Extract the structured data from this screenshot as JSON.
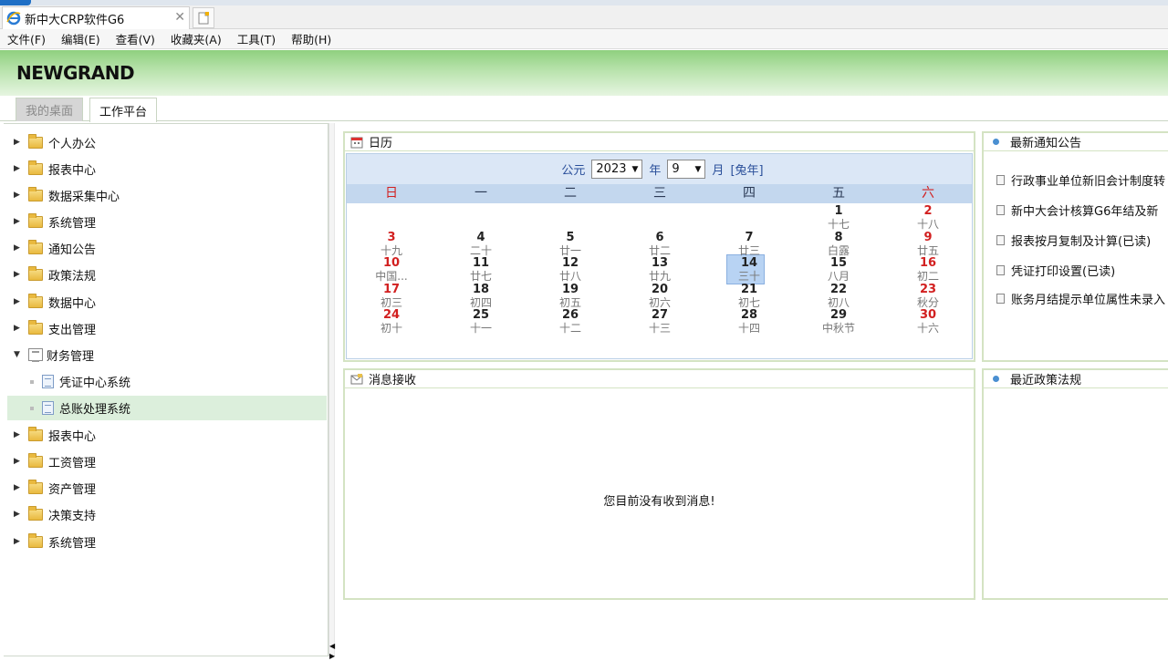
{
  "browser": {
    "tab_title": "新中大CRP软件G6",
    "close_glyph": "✕",
    "menu": [
      "文件(F)",
      "编辑(E)",
      "查看(V)",
      "收藏夹(A)",
      "工具(T)",
      "帮助(H)"
    ]
  },
  "app": {
    "logo": "NEWGRAND",
    "tabs": [
      "我的桌面",
      "工作平台"
    ]
  },
  "sidebar": {
    "items": [
      {
        "label": "个人办公"
      },
      {
        "label": "报表中心"
      },
      {
        "label": "数据采集中心"
      },
      {
        "label": "系统管理"
      },
      {
        "label": "通知公告"
      },
      {
        "label": "政策法规"
      },
      {
        "label": "数据中心"
      },
      {
        "label": "支出管理"
      },
      {
        "label": "财务管理",
        "expanded": true
      },
      {
        "label": "报表中心"
      },
      {
        "label": "工资管理"
      },
      {
        "label": "资产管理"
      },
      {
        "label": "决策支持"
      },
      {
        "label": "系统管理"
      }
    ],
    "finance_children": [
      "凭证中心系统",
      "总账处理系统"
    ],
    "selected_child": "总账处理系统"
  },
  "calendar": {
    "title": "日历",
    "era_label": "公元",
    "year": "2023",
    "year_unit": "年",
    "month": "9",
    "month_unit": "月",
    "zodiac": "[兔年]",
    "weekdays": [
      "日",
      "一",
      "二",
      "三",
      "四",
      "五",
      "六"
    ],
    "days": [
      {
        "n": "1",
        "l": "十七",
        "col": 5,
        "row": 0
      },
      {
        "n": "2",
        "l": "十八",
        "col": 6,
        "row": 0
      },
      {
        "n": "3",
        "l": "十九",
        "col": 0,
        "row": 1
      },
      {
        "n": "4",
        "l": "二十",
        "col": 1,
        "row": 1
      },
      {
        "n": "5",
        "l": "廿一",
        "col": 2,
        "row": 1
      },
      {
        "n": "6",
        "l": "廿二",
        "col": 3,
        "row": 1
      },
      {
        "n": "7",
        "l": "廿三",
        "col": 4,
        "row": 1
      },
      {
        "n": "8",
        "l": "白露",
        "col": 5,
        "row": 1
      },
      {
        "n": "9",
        "l": "廿五",
        "col": 6,
        "row": 1
      },
      {
        "n": "10",
        "l": "中国...",
        "col": 0,
        "row": 2
      },
      {
        "n": "11",
        "l": "廿七",
        "col": 1,
        "row": 2
      },
      {
        "n": "12",
        "l": "廿八",
        "col": 2,
        "row": 2
      },
      {
        "n": "13",
        "l": "廿九",
        "col": 3,
        "row": 2
      },
      {
        "n": "14",
        "l": "三十",
        "col": 4,
        "row": 2,
        "today": true
      },
      {
        "n": "15",
        "l": "八月",
        "col": 5,
        "row": 2
      },
      {
        "n": "16",
        "l": "初二",
        "col": 6,
        "row": 2
      },
      {
        "n": "17",
        "l": "初三",
        "col": 0,
        "row": 3
      },
      {
        "n": "18",
        "l": "初四",
        "col": 1,
        "row": 3
      },
      {
        "n": "19",
        "l": "初五",
        "col": 2,
        "row": 3
      },
      {
        "n": "20",
        "l": "初六",
        "col": 3,
        "row": 3
      },
      {
        "n": "21",
        "l": "初七",
        "col": 4,
        "row": 3
      },
      {
        "n": "22",
        "l": "初八",
        "col": 5,
        "row": 3
      },
      {
        "n": "23",
        "l": "秋分",
        "col": 6,
        "row": 3
      },
      {
        "n": "24",
        "l": "初十",
        "col": 0,
        "row": 4
      },
      {
        "n": "25",
        "l": "十一",
        "col": 1,
        "row": 4
      },
      {
        "n": "26",
        "l": "十二",
        "col": 2,
        "row": 4
      },
      {
        "n": "27",
        "l": "十三",
        "col": 3,
        "row": 4
      },
      {
        "n": "28",
        "l": "十四",
        "col": 4,
        "row": 4
      },
      {
        "n": "29",
        "l": "中秋节",
        "col": 5,
        "row": 4
      },
      {
        "n": "30",
        "l": "十六",
        "col": 6,
        "row": 4
      }
    ]
  },
  "notices": {
    "title": "最新通知公告",
    "items": [
      "行政事业单位新旧会计制度转",
      "新中大会计核算G6年结及新",
      "报表按月复制及计算(已读)",
      "凭证打印设置(已读)",
      "账务月结提示单位属性未录入"
    ]
  },
  "messages": {
    "title": "消息接收",
    "empty_text": "您目前没有收到消息!"
  },
  "policies": {
    "title": "最近政策法规"
  },
  "colors": {
    "header_green": "#8fd07f",
    "panel_border": "#d4e3c3",
    "calendar_blue": "#dbe7f6",
    "weekend_red": "#d22020",
    "selected_green": "#dcefdc"
  }
}
